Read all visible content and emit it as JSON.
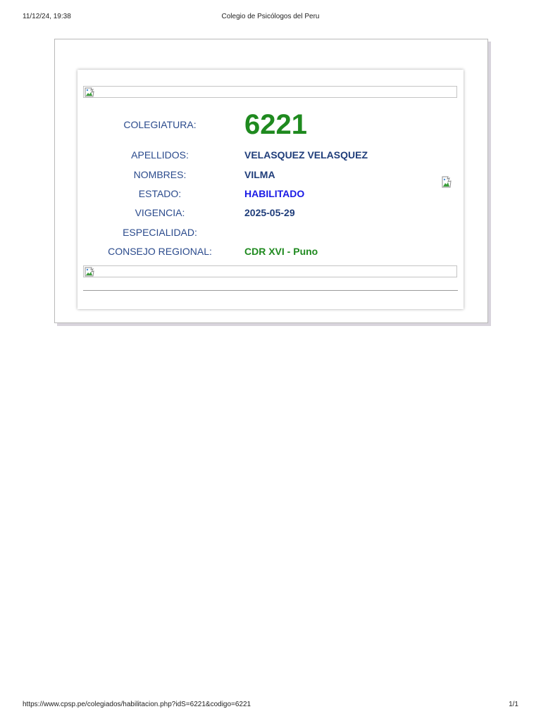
{
  "print_header": {
    "datetime": "11/12/24, 19:38",
    "title": "Colegio de Psicólogos del Peru"
  },
  "print_footer": {
    "url": "https://www.cpsp.pe/colegiados/habilitacion.php?idS=6221&codigo=6221",
    "page": "1/1"
  },
  "record": {
    "colegiatura_label": "COLEGIATURA:",
    "colegiatura_value": "6221",
    "apellidos_label": "APELLIDOS:",
    "apellidos_value": "VELASQUEZ VELASQUEZ",
    "nombres_label": "NOMBRES:",
    "nombres_value": "VILMA",
    "estado_label": "ESTADO:",
    "estado_value": "HABILITADO",
    "vigencia_label": "VIGENCIA:",
    "vigencia_value": "2025-05-29",
    "especialidad_label": "ESPECIALIDAD:",
    "especialidad_value": "",
    "consejo_label": "CONSEJO REGIONAL:",
    "consejo_value": "CDR XVI - Puno"
  },
  "colors": {
    "label": "#2a4a8c",
    "value": "#1f3d7a",
    "colegiatura": "#1f8a1f",
    "estado": "#1a1ae6",
    "consejo": "#1f8a1f"
  },
  "icons": {
    "banner_top": "broken-image-icon",
    "banner_bottom": "broken-image-icon",
    "side": "broken-image-icon"
  }
}
